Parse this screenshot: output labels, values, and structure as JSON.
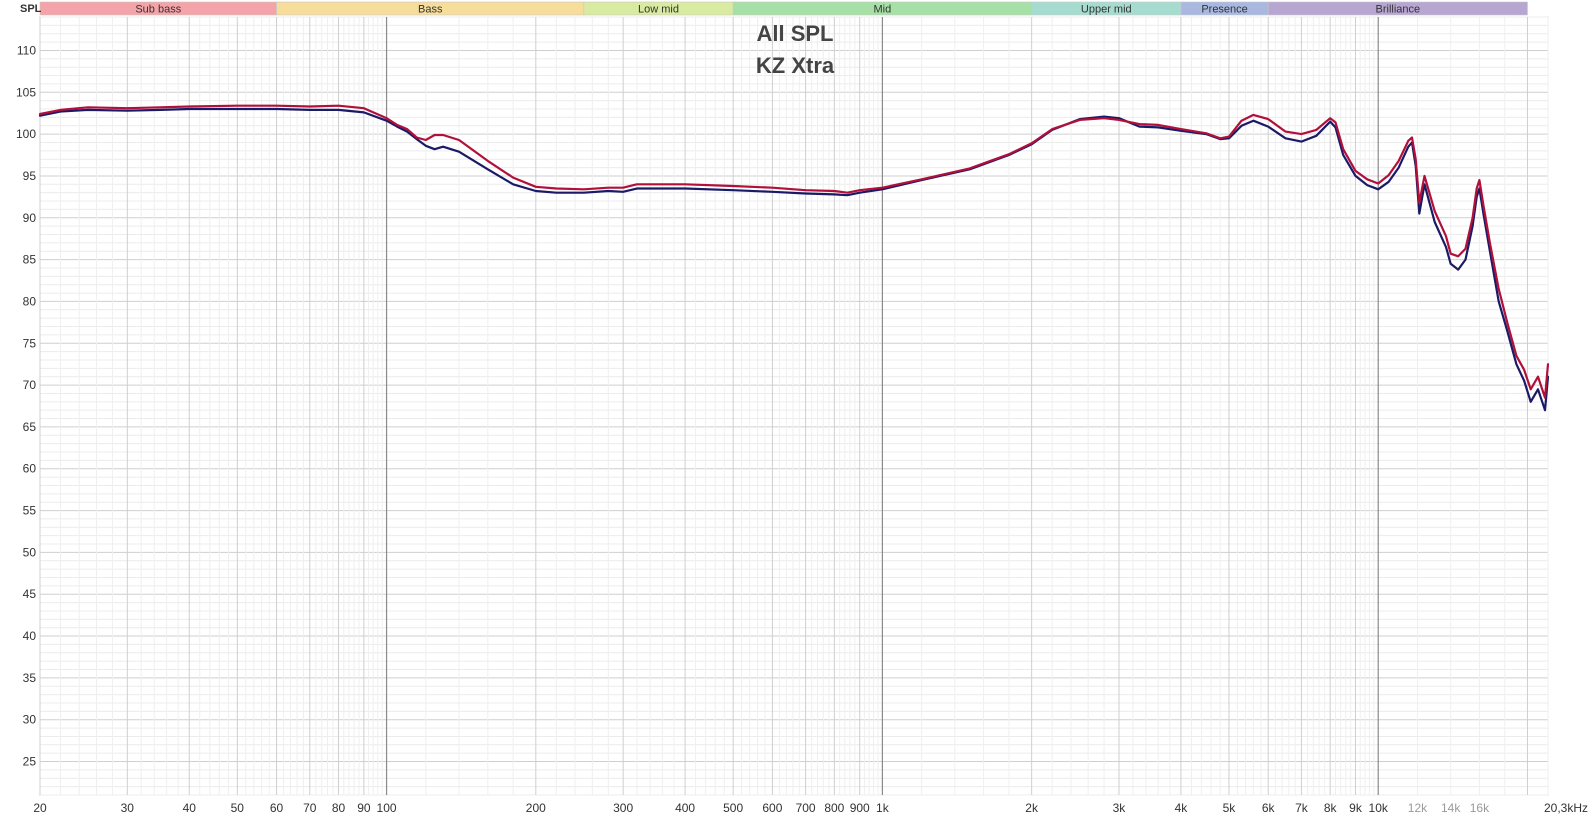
{
  "chart_data": {
    "type": "line",
    "title": "All SPL",
    "subtitle": "KZ Xtra",
    "ylabel": "SPL",
    "xlabel": "",
    "x_unit_suffix": "Hz",
    "xscale": "log",
    "xlim": [
      20,
      22000
    ],
    "ylim": [
      21,
      114
    ],
    "grid": true,
    "legend": "none",
    "bands": [
      {
        "label": "Sub bass",
        "from": 20,
        "to": 60,
        "color": "#f4a4a8"
      },
      {
        "label": "Bass",
        "from": 60,
        "to": 250,
        "color": "#f7dd9a"
      },
      {
        "label": "Low mid",
        "from": 250,
        "to": 500,
        "color": "#d8eba0"
      },
      {
        "label": "Mid",
        "from": 500,
        "to": 2000,
        "color": "#a6e0a6"
      },
      {
        "label": "Upper mid",
        "from": 2000,
        "to": 4000,
        "color": "#a6dccf"
      },
      {
        "label": "Presence",
        "from": 4000,
        "to": 6000,
        "color": "#a9b8e0"
      },
      {
        "label": "Brilliance",
        "from": 6000,
        "to": 20000,
        "color": "#b8a6d2"
      }
    ],
    "yticks": [
      25,
      30,
      35,
      40,
      45,
      50,
      55,
      60,
      65,
      70,
      75,
      80,
      85,
      90,
      95,
      100,
      105,
      110
    ],
    "xticks": [
      {
        "v": 20,
        "label": "20"
      },
      {
        "v": 30,
        "label": "30"
      },
      {
        "v": 40,
        "label": "40"
      },
      {
        "v": 50,
        "label": "50"
      },
      {
        "v": 60,
        "label": "60"
      },
      {
        "v": 70,
        "label": "70"
      },
      {
        "v": 80,
        "label": "80"
      },
      {
        "v": 90,
        "label": "90"
      },
      {
        "v": 100,
        "label": "100"
      },
      {
        "v": 200,
        "label": "200"
      },
      {
        "v": 300,
        "label": "300"
      },
      {
        "v": 400,
        "label": "400"
      },
      {
        "v": 500,
        "label": "500"
      },
      {
        "v": 600,
        "label": "600"
      },
      {
        "v": 700,
        "label": "700"
      },
      {
        "v": 800,
        "label": "800"
      },
      {
        "v": 900,
        "label": "900"
      },
      {
        "v": 1000,
        "label": "1k"
      },
      {
        "v": 2000,
        "label": "2k"
      },
      {
        "v": 3000,
        "label": "3k"
      },
      {
        "v": 4000,
        "label": "4k"
      },
      {
        "v": 5000,
        "label": "5k"
      },
      {
        "v": 6000,
        "label": "6k"
      },
      {
        "v": 7000,
        "label": "7k"
      },
      {
        "v": 8000,
        "label": "8k"
      },
      {
        "v": 9000,
        "label": "9k"
      },
      {
        "v": 10000,
        "label": "10k"
      },
      {
        "v": 12000,
        "label": "12k",
        "faded": true
      },
      {
        "v": 14000,
        "label": "14k",
        "faded": true
      },
      {
        "v": 16000,
        "label": "16k",
        "faded": true
      },
      {
        "v": 20300,
        "label": "20,3kHz"
      }
    ],
    "series": [
      {
        "color": "#1a1a66",
        "x": [
          20,
          22,
          25,
          30,
          35,
          40,
          50,
          60,
          70,
          80,
          90,
          100,
          105,
          110,
          115,
          120,
          125,
          130,
          140,
          160,
          180,
          200,
          220,
          250,
          280,
          300,
          320,
          350,
          400,
          500,
          600,
          700,
          800,
          850,
          900,
          1000,
          1200,
          1500,
          1800,
          2000,
          2200,
          2500,
          2800,
          3000,
          3300,
          3600,
          4000,
          4500,
          4800,
          5000,
          5300,
          5600,
          6000,
          6500,
          7000,
          7500,
          8000,
          8200,
          8500,
          9000,
          9500,
          10000,
          10500,
          11000,
          11500,
          11700,
          11900,
          12100,
          12400,
          13000,
          13700,
          14000,
          14500,
          15000,
          15500,
          15800,
          16000,
          16300,
          16800,
          17500,
          18200,
          19000,
          19700,
          20300,
          21000,
          21700,
          22000
        ],
        "y": [
          102.2,
          102.7,
          102.9,
          102.8,
          102.9,
          103.0,
          103.0,
          103.0,
          102.9,
          102.9,
          102.6,
          101.6,
          100.9,
          100.3,
          99.4,
          98.6,
          98.2,
          98.5,
          97.9,
          95.8,
          94.0,
          93.2,
          93.0,
          93.0,
          93.2,
          93.1,
          93.5,
          93.5,
          93.5,
          93.3,
          93.1,
          92.9,
          92.8,
          92.7,
          93.0,
          93.4,
          94.5,
          95.8,
          97.5,
          98.8,
          100.5,
          101.8,
          102.1,
          101.9,
          100.9,
          100.8,
          100.4,
          100.0,
          99.4,
          99.5,
          101.0,
          101.6,
          100.9,
          99.5,
          99.1,
          99.8,
          101.5,
          100.8,
          97.5,
          95.0,
          93.9,
          93.4,
          94.3,
          96.0,
          98.5,
          99.0,
          96.2,
          90.5,
          94.0,
          89.5,
          86.5,
          84.5,
          83.8,
          85.0,
          89.0,
          92.5,
          93.5,
          90.5,
          86.0,
          80.0,
          76.5,
          72.5,
          70.5,
          68.0,
          69.5,
          67.0,
          71.0
        ]
      },
      {
        "color": "#b0103a",
        "x": [
          20,
          22,
          25,
          30,
          35,
          40,
          50,
          60,
          70,
          80,
          90,
          100,
          105,
          110,
          115,
          120,
          125,
          130,
          140,
          160,
          180,
          200,
          220,
          250,
          280,
          300,
          320,
          350,
          400,
          500,
          600,
          700,
          800,
          850,
          900,
          1000,
          1200,
          1500,
          1800,
          2000,
          2200,
          2500,
          2800,
          3000,
          3300,
          3600,
          4000,
          4500,
          4800,
          5000,
          5300,
          5600,
          6000,
          6500,
          7000,
          7500,
          8000,
          8200,
          8500,
          9000,
          9500,
          10000,
          10500,
          11000,
          11500,
          11700,
          11900,
          12100,
          12400,
          13000,
          13700,
          14000,
          14500,
          15000,
          15500,
          15800,
          16000,
          16300,
          16800,
          17500,
          18200,
          19000,
          19700,
          20300,
          21000,
          21700,
          22000
        ],
        "y": [
          102.4,
          102.9,
          103.2,
          103.1,
          103.2,
          103.3,
          103.4,
          103.4,
          103.3,
          103.4,
          103.1,
          101.9,
          101.1,
          100.6,
          99.6,
          99.3,
          99.9,
          99.9,
          99.3,
          96.8,
          94.8,
          93.7,
          93.5,
          93.4,
          93.6,
          93.6,
          94.0,
          94.0,
          94.0,
          93.8,
          93.6,
          93.3,
          93.2,
          93.0,
          93.3,
          93.6,
          94.6,
          95.9,
          97.6,
          98.9,
          100.6,
          101.7,
          101.9,
          101.7,
          101.2,
          101.1,
          100.6,
          100.1,
          99.5,
          99.7,
          101.6,
          102.3,
          101.8,
          100.3,
          100.0,
          100.5,
          101.9,
          101.4,
          98.2,
          95.6,
          94.6,
          94.1,
          95.1,
          96.8,
          99.2,
          99.6,
          97.0,
          91.8,
          95.0,
          90.8,
          87.8,
          85.7,
          85.4,
          86.3,
          90.0,
          93.5,
          94.5,
          91.5,
          87.0,
          81.5,
          77.5,
          73.5,
          71.8,
          69.5,
          71.0,
          68.5,
          72.5
        ]
      }
    ]
  }
}
